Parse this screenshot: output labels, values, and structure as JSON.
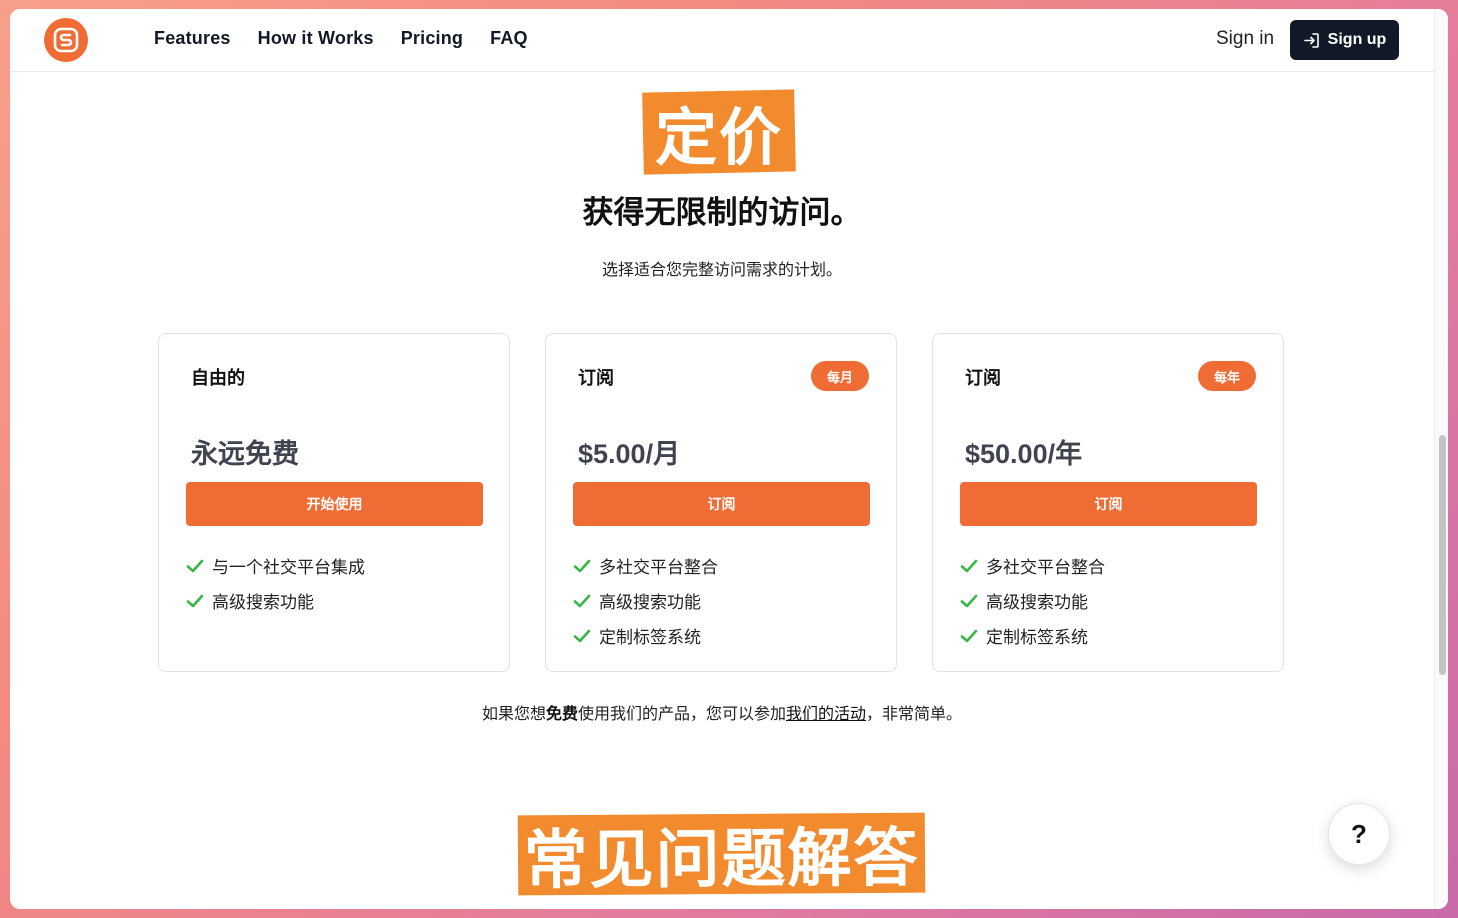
{
  "header": {
    "nav": [
      "Features",
      "How it Works",
      "Pricing",
      "FAQ"
    ],
    "signin": "Sign in",
    "signup": "Sign up"
  },
  "hero": {
    "title": "定价",
    "subtitle": "获得无限制的访问。",
    "description": "选择适合您完整访问需求的计划。"
  },
  "plans": [
    {
      "name": "自由的",
      "badge": "",
      "price": "永远免费",
      "cta": "开始使用",
      "features": [
        "与一个社交平台集成",
        "高级搜索功能"
      ]
    },
    {
      "name": "订阅",
      "badge": "每月",
      "price": "$5.00/月",
      "cta": "订阅",
      "features": [
        "多社交平台整合",
        "高级搜索功能",
        "定制标签系统"
      ]
    },
    {
      "name": "订阅",
      "badge": "每年",
      "price": "$50.00/年",
      "cta": "订阅",
      "features": [
        "多社交平台整合",
        "高级搜索功能",
        "定制标签系统"
      ]
    }
  ],
  "footnote": {
    "before": "如果您想",
    "bold": "免费",
    "middle": "使用我们的产品，您可以参加",
    "link": "我们的活动",
    "after": "，非常简单。"
  },
  "faq": {
    "title": "常见问题解答"
  },
  "help": {
    "label": "?"
  },
  "colors": {
    "accent": "#ef6c35",
    "highlight": "#f28a2e",
    "dark": "#111827",
    "check": "#3bb54a"
  }
}
